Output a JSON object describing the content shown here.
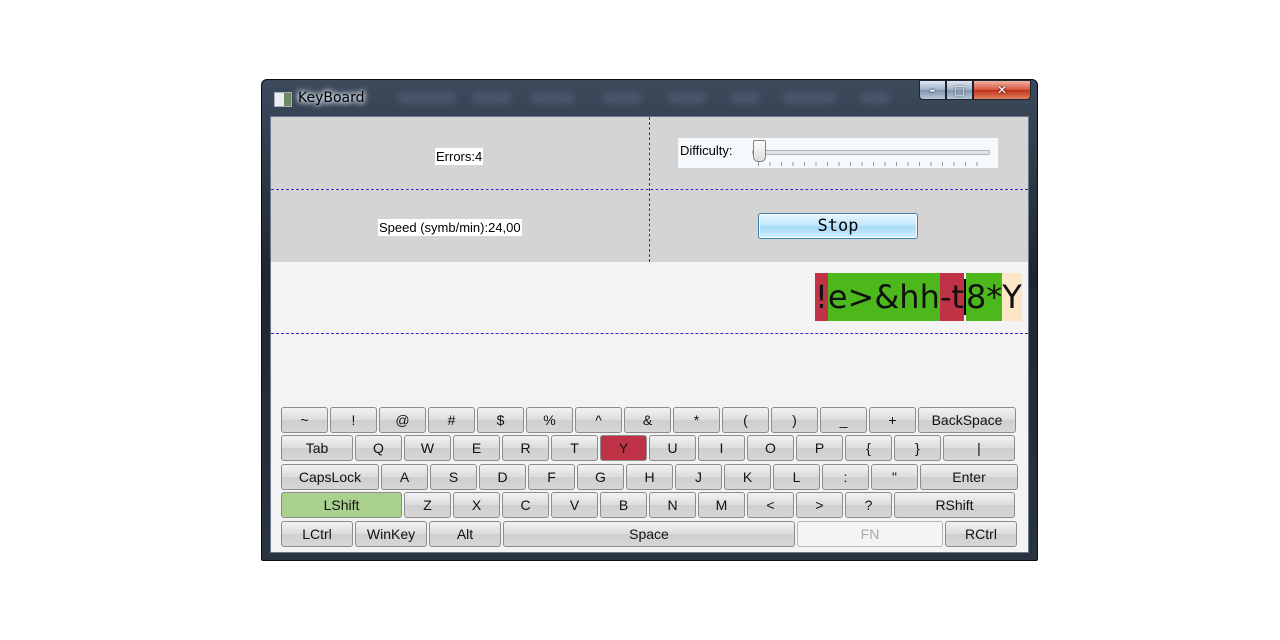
{
  "window": {
    "title": "KeyBoard",
    "controls": {
      "minimize": "–",
      "maximize": "□",
      "close": "✕"
    }
  },
  "stats": {
    "errors": "Errors:4",
    "speed": "Speed (symb/min):24,00"
  },
  "difficulty": {
    "label": "Difficulty:",
    "level": 0
  },
  "stop_button": "Stop",
  "typed_text": [
    {
      "c": "!",
      "state": "err"
    },
    {
      "c": "e",
      "state": "ok"
    },
    {
      "c": ">",
      "state": "ok"
    },
    {
      "c": "&",
      "state": "ok"
    },
    {
      "c": "h",
      "state": "ok"
    },
    {
      "c": "h",
      "state": "ok"
    },
    {
      "c": "-",
      "state": "err"
    },
    {
      "c": "t",
      "state": "err"
    },
    {
      "c": "8",
      "state": "ok"
    },
    {
      "c": "*",
      "state": "ok"
    },
    {
      "c": "Y",
      "state": "next"
    }
  ],
  "keyboard": {
    "row1": [
      "~",
      "!",
      "@",
      "#",
      "$",
      "%",
      "^",
      "&",
      "*",
      "(",
      ")",
      "_",
      "+",
      "BackSpace"
    ],
    "row2": [
      "Tab",
      "Q",
      "W",
      "E",
      "R",
      "T",
      "Y",
      "U",
      "I",
      "O",
      "P",
      "{",
      "}",
      "|"
    ],
    "row3": [
      "CapsLock",
      "A",
      "S",
      "D",
      "F",
      "G",
      "H",
      "J",
      "K",
      "L",
      ":",
      "\"",
      "Enter"
    ],
    "row4": [
      "LShift",
      "Z",
      "X",
      "C",
      "V",
      "B",
      "N",
      "M",
      "<",
      ">",
      "?",
      "RShift"
    ],
    "row5": [
      "LCtrl",
      "WinKey",
      "Alt",
      "Space",
      "FN",
      "RCtrl"
    ],
    "highlight_red": "Y",
    "highlight_green": "LShift",
    "disabled": "FN"
  }
}
